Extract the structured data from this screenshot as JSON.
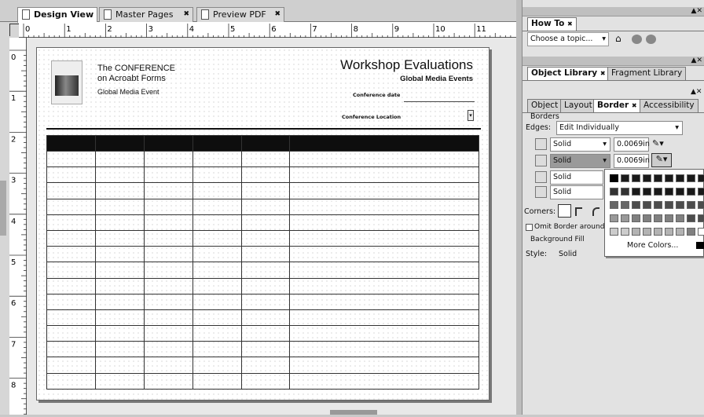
{
  "editor_tabs": [
    {
      "label": "Design View",
      "active": true
    },
    {
      "label": "Master Pages",
      "active": false
    },
    {
      "label": "Preview PDF",
      "active": false
    }
  ],
  "ruler": {
    "h": [
      "0",
      "1",
      "2",
      "3",
      "4",
      "5",
      "6",
      "7",
      "8",
      "9",
      "10",
      "11"
    ],
    "v": [
      "0",
      "1",
      "2",
      "3",
      "4",
      "5",
      "6",
      "7",
      "8"
    ]
  },
  "form": {
    "conference_line1": "The CONFERENCE",
    "conference_line2": "on Acroabt Forms",
    "event_name": "Global Media Event",
    "title": "Workshop Evaluations",
    "subtitle": "Global Media Events",
    "date_label": "Conference date",
    "location_label": "Conference Location",
    "table": {
      "columns": 6,
      "rows": 15
    }
  },
  "panels": {
    "howto": {
      "title": "How To",
      "topic_placeholder": "Choose a topic..."
    },
    "library_tabs": [
      "Object Library",
      "Fragment Library"
    ],
    "object_tabs": [
      "Object",
      "Layout",
      "Border",
      "Accessibility"
    ],
    "borders": {
      "section": "Borders",
      "edges_label": "Edges:",
      "edges_value": "Edit Individually",
      "rows": [
        {
          "style": "Solid",
          "width": "0.0069in"
        },
        {
          "style": "Solid",
          "width": "0.0069in"
        },
        {
          "style": "Solid",
          "width": ""
        },
        {
          "style": "Solid",
          "width": ""
        }
      ],
      "corners_label": "Corners:",
      "omit_label": "Omit Border around",
      "bg_section": "Background Fill",
      "style_label": "Style:",
      "style_value": "Solid"
    },
    "palette": {
      "more_colors": "More Colors...",
      "colors": [
        "#000000",
        "#1a1a1a",
        "#333333",
        "#4d4d4d",
        "#666666",
        "#808080",
        "#999999",
        "#b3b3b3",
        "#cccccc",
        "#e6e6e6",
        "#ffffff"
      ]
    }
  }
}
